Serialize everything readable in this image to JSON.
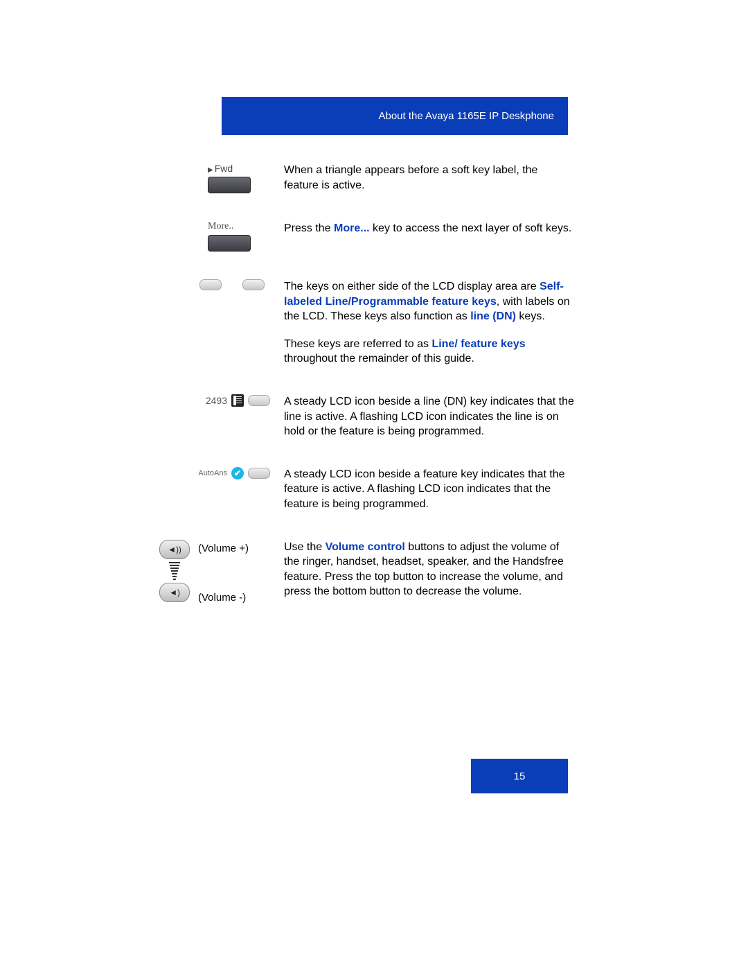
{
  "header": {
    "title": "About the Avaya 1165E IP Deskphone"
  },
  "rows": {
    "fwd": {
      "label": "Fwd",
      "text": "When a triangle appears before a soft key label, the feature is active."
    },
    "more": {
      "label": "More..",
      "pre": "Press the ",
      "bold": "More...",
      "post": " key to access the next layer of soft keys."
    },
    "sidekeys": {
      "p1_pre": "The keys on either side of the LCD display area are ",
      "p1_bold1": "Self-labeled Line/Programmable feature keys",
      "p1_mid": ", with labels on the LCD. These keys also function as ",
      "p1_bold2": "line (DN)",
      "p1_post": " keys.",
      "p2_pre": "These keys are referred to as ",
      "p2_bold": "Line/ feature keys",
      "p2_post": " throughout the remainder of this guide."
    },
    "linedn": {
      "number": "2493",
      "text": "A steady LCD icon beside a line (DN) key indicates that the line is active. A flashing LCD icon indicates the line is on hold or the feature is being programmed."
    },
    "autoans": {
      "label": "AutoAns",
      "text": "A steady LCD icon beside a feature key indicates that the feature is active. A flashing LCD icon indicates that the feature is being programmed."
    },
    "volume": {
      "up_label": "(Volume +)",
      "down_label": "(Volume -)",
      "pre": "Use the ",
      "bold": "Volume control",
      "post": " buttons to adjust the volume of the ringer, handset, headset, speaker, and the Handsfree feature. Press the top button to increase the volume, and press the bottom button to decrease the volume."
    }
  },
  "page_number": "15"
}
